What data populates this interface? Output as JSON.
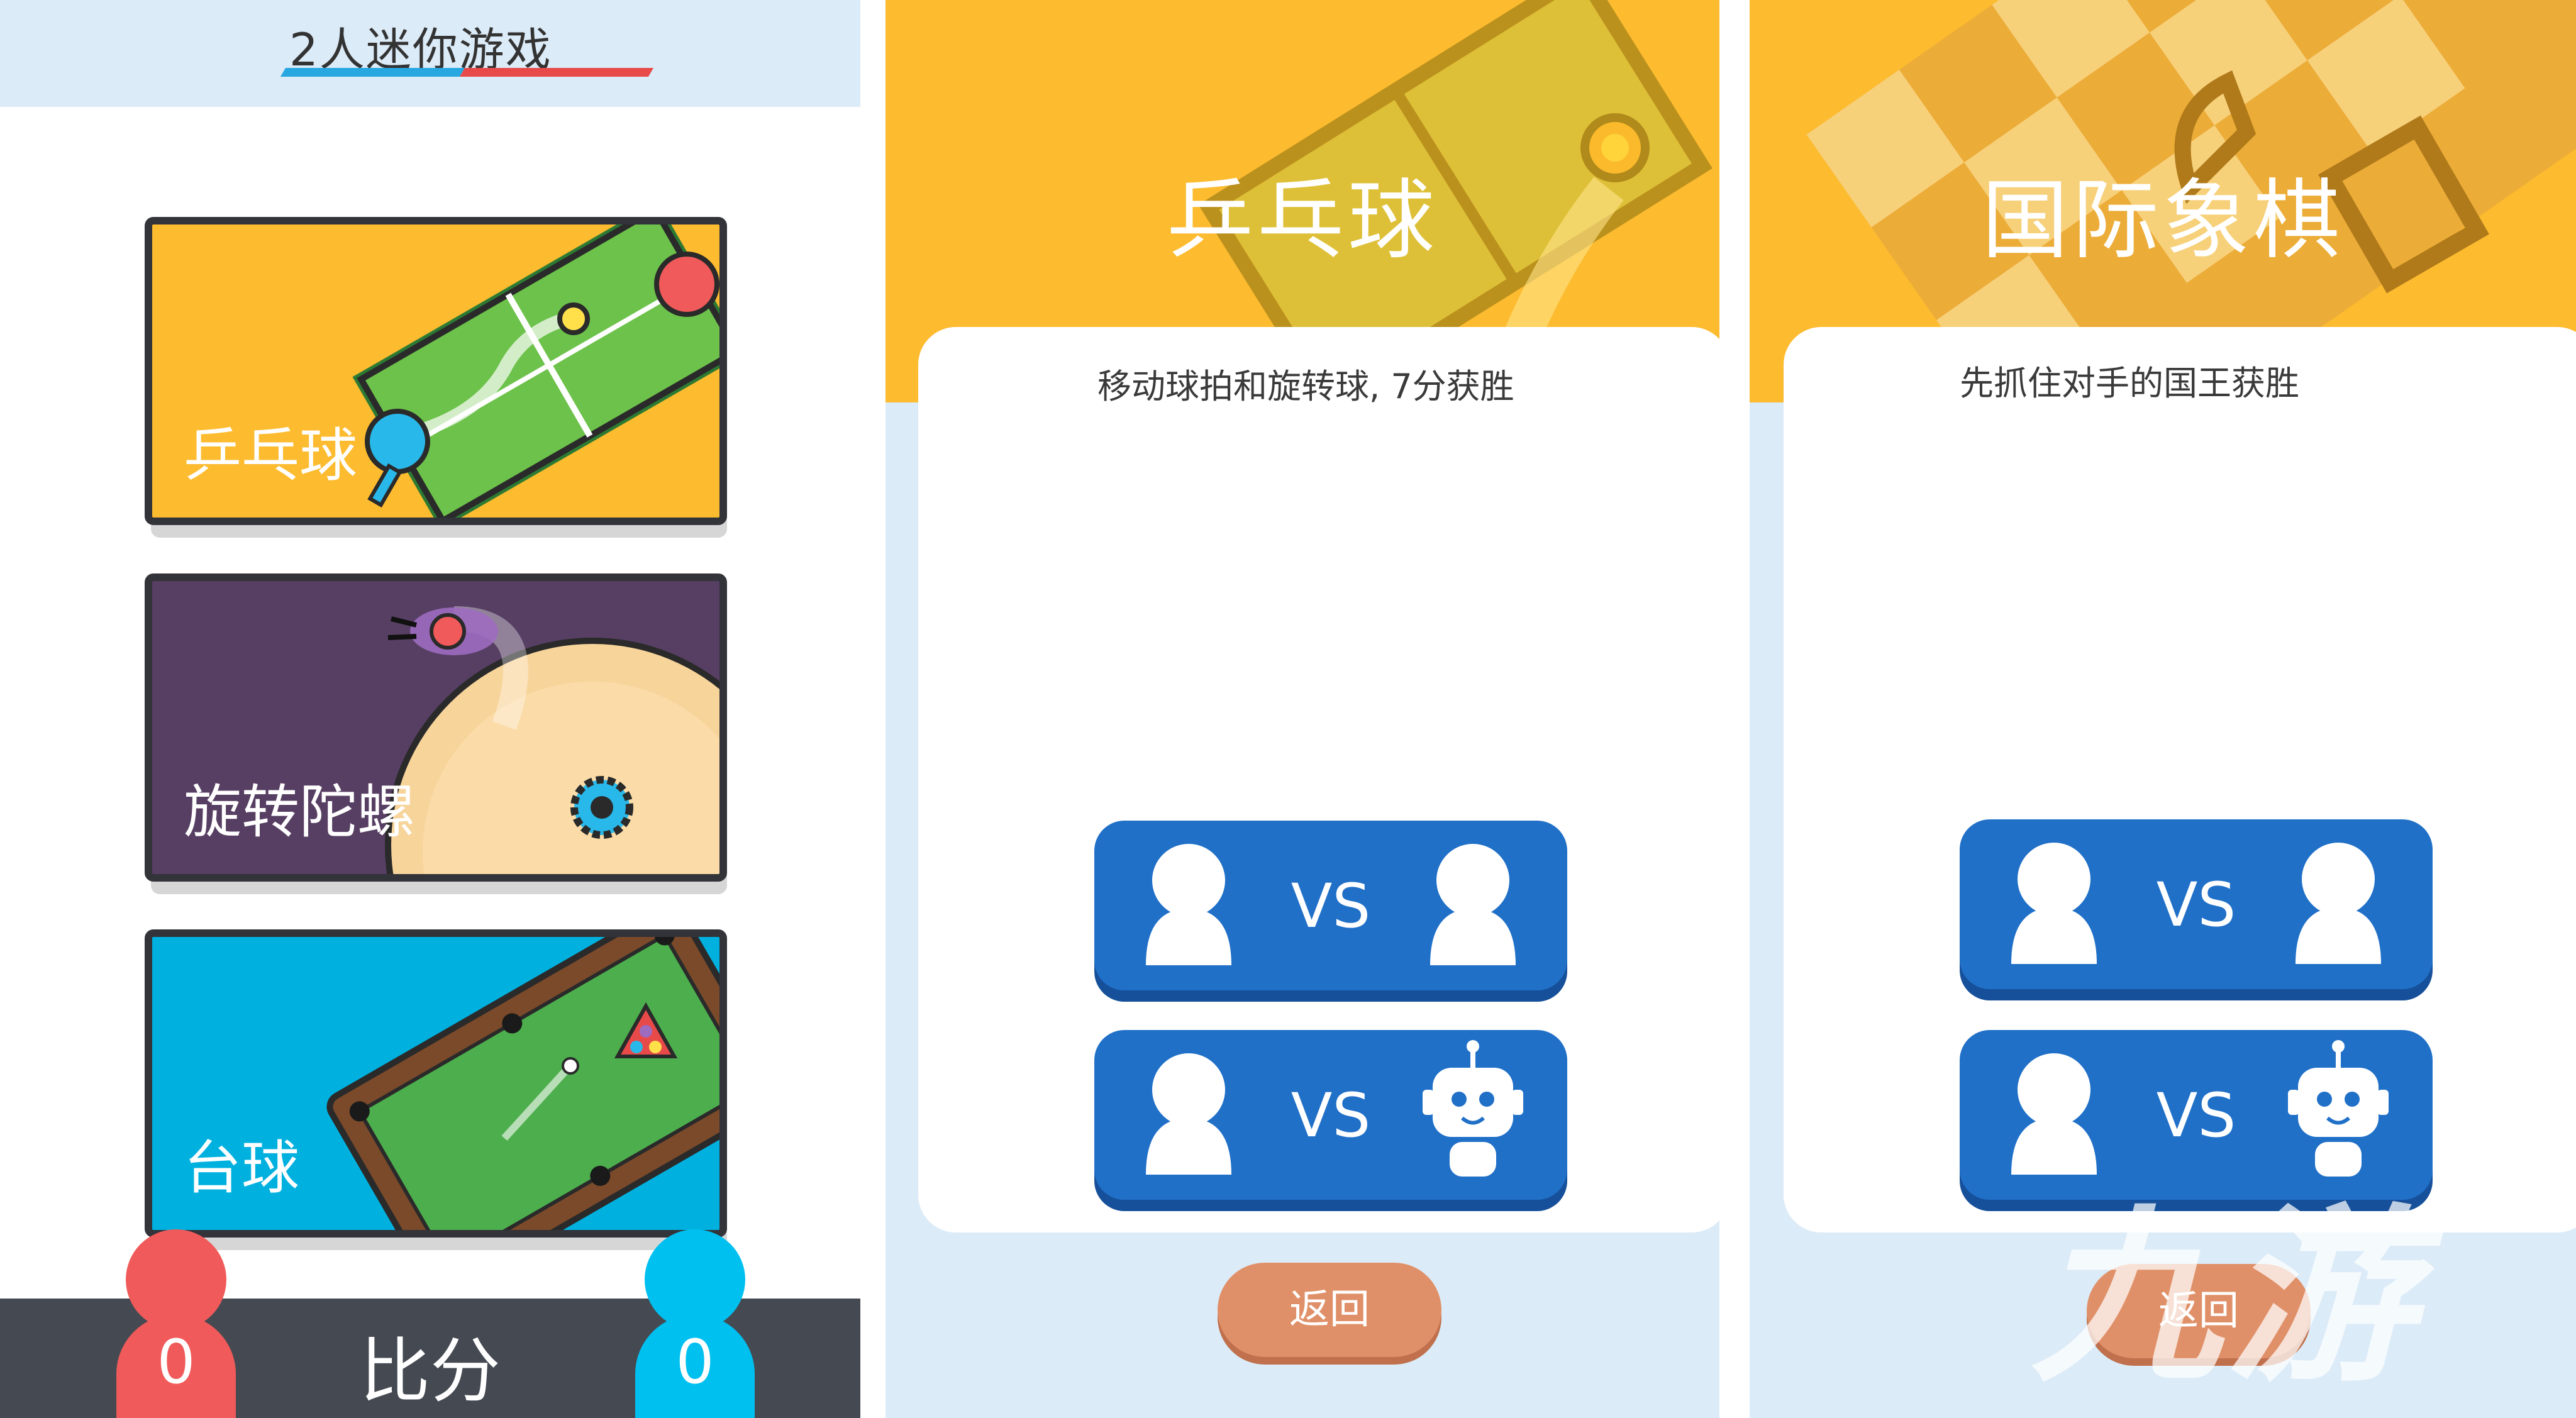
{
  "menu": {
    "app_title": "2人迷你游戏",
    "games": [
      {
        "label": "乒乓球"
      },
      {
        "label": "旋转陀螺"
      },
      {
        "label": "台球"
      }
    ],
    "score": {
      "label": "比分",
      "red": "0",
      "blue": "0"
    }
  },
  "pingpong": {
    "title": "乒乓球",
    "description": "移动球拍和旋转球, 7分获胜",
    "vs_human": "VS",
    "vs_ai": "VS",
    "back": "返回"
  },
  "chess": {
    "title": "国际象棋",
    "description": "先抓住对手的国王获胜",
    "vs_human": "VS",
    "vs_ai": "VS",
    "back": "返回"
  },
  "watermark": "九游",
  "colors": {
    "yellow": "#fdbb2f",
    "purple": "#573f63",
    "cyan": "#00b1e0",
    "button_blue": "#2070c8",
    "back_orange": "#e09068",
    "red_player": "#f05a5a",
    "blue_player": "#00c0f0"
  }
}
